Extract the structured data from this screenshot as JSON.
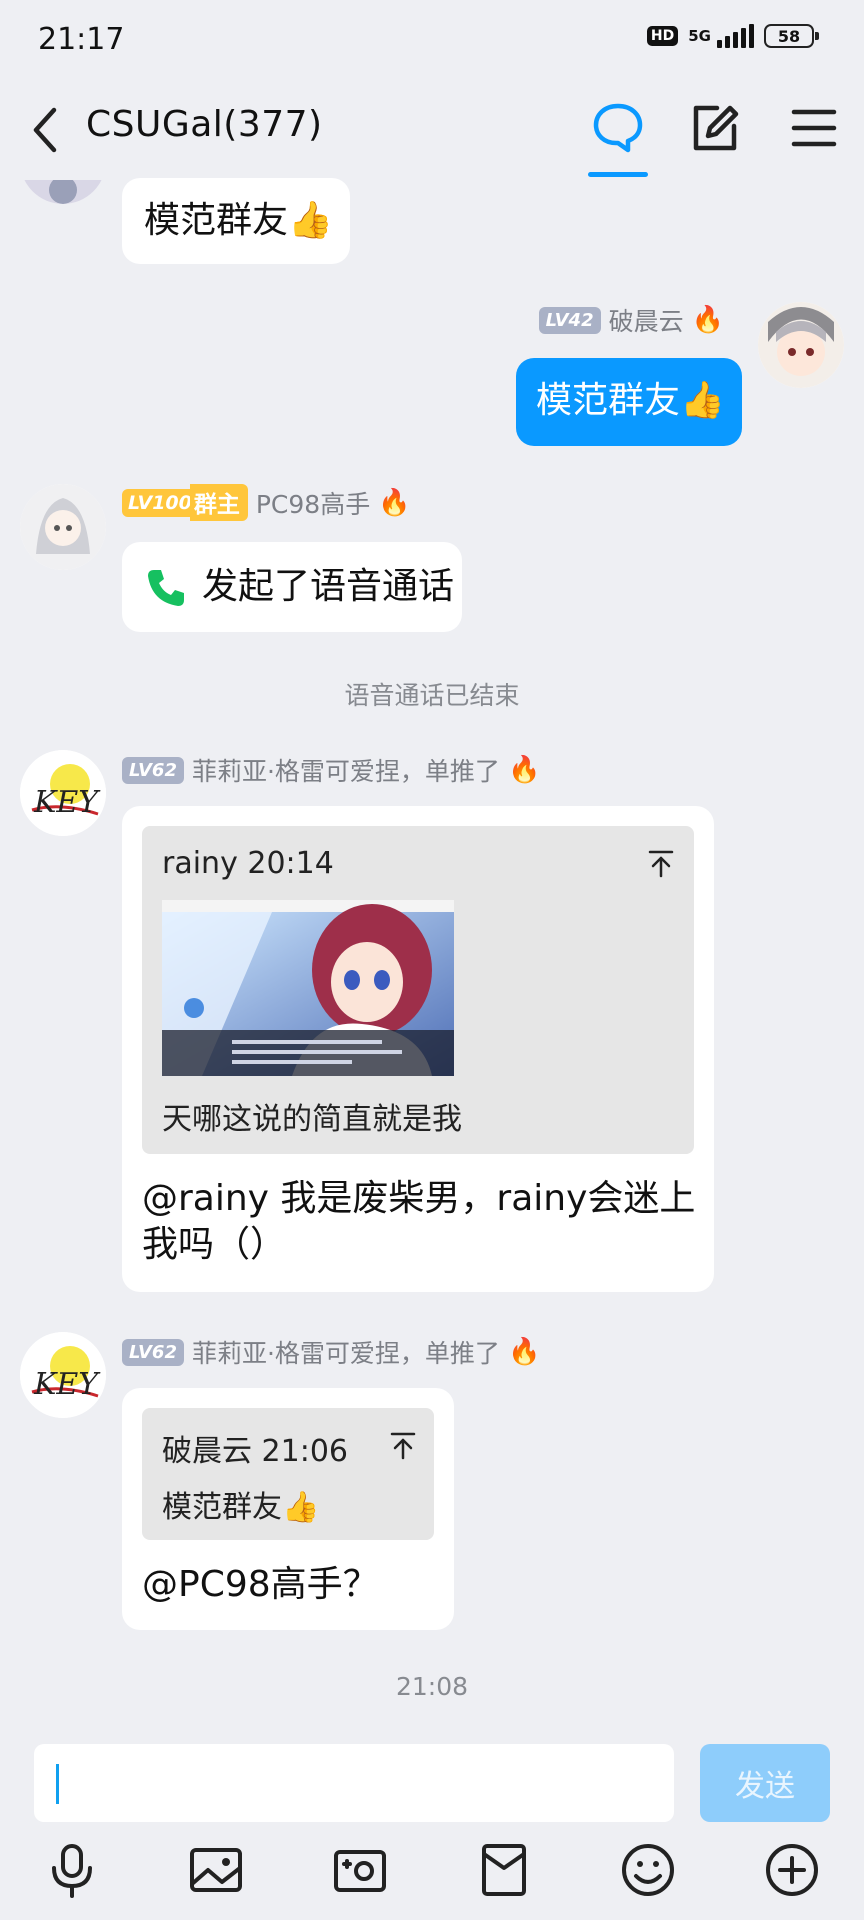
{
  "status_bar": {
    "time": "21:17",
    "hd": "HD",
    "network": "5G",
    "battery": "58"
  },
  "header": {
    "title": "CSUGal(377)"
  },
  "messages": [
    {
      "text": "模范群友👍"
    },
    {
      "level": "LV42",
      "name": "破晨云",
      "text": "模范群友👍"
    },
    {
      "level": "LV100",
      "role": "群主",
      "name": "PC98高手",
      "text": "发起了语音通话"
    },
    {
      "level": "LV62",
      "name": "菲莉亚·格雷可爱捏，单推了",
      "quote": {
        "author_time": "rainy 20:14",
        "text": "天哪这说的简直就是我"
      },
      "text": "@rainy 我是废柴男，rainy会迷上我吗（）"
    },
    {
      "level": "LV62",
      "name": "菲莉亚·格雷可爱捏，单推了",
      "quote": {
        "author_time": "破晨云 21:06",
        "text": "模范群友👍"
      },
      "text": "@PC98高手？"
    }
  ],
  "system": {
    "call_ended": "语音通话已结束",
    "time_divider": "21:08"
  },
  "input": {
    "placeholder": "",
    "send_label": "发送"
  },
  "icons": [
    "back-icon",
    "chat-icon",
    "edit-icon",
    "menu-icon",
    "mic-icon",
    "image-icon",
    "camera-icon",
    "red-packet-icon",
    "emoji-icon",
    "plus-icon",
    "phone-icon",
    "pin-icon",
    "fire-icon"
  ],
  "colors": {
    "accent": "#0a99ff",
    "own_bubble": "#0a99ff",
    "background": "#eeeff3",
    "level_badge": "#a9b1c6",
    "owner_badge": "#ffc63b",
    "send_disabled": "#8ecdfb",
    "phone": "#16c060"
  }
}
